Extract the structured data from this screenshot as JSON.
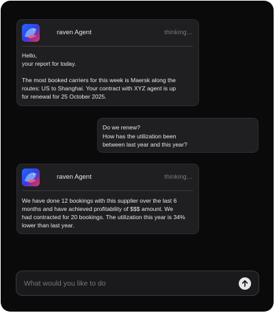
{
  "messages": [
    {
      "agent_name": "raven Agent",
      "status": "thinking...",
      "paragraphs": [
        "Hello,\nyour report for today.",
        "The most booked carriers for this week is Maersk along the\nroutes: US to Shanghai. Your contract with XYZ agent is up\nfor renewal for 25 October 2025."
      ]
    },
    {
      "agent_name": "raven Agent",
      "status": "thinking...",
      "paragraphs": [
        "We have done 12 bookings with this supplier over the last 6\nmonths and have achieved profitability of $$$ amount. We\nhad contracted for 20 bookings. The utilization this year is 34%\nlower than last year."
      ]
    }
  ],
  "user_message": {
    "lines": [
      "Do we renew?",
      "How has the utilization been",
      "between last year and this year?"
    ]
  },
  "composer": {
    "placeholder": "What would you like to do"
  },
  "icons": {
    "avatar": "raven-logo-icon",
    "send": "arrow-up-icon"
  },
  "colors": {
    "background": "#0a0a0b",
    "card": "#1f1f22",
    "accent_blue": "#2f5bff",
    "accent_red": "#ff3b3b"
  }
}
